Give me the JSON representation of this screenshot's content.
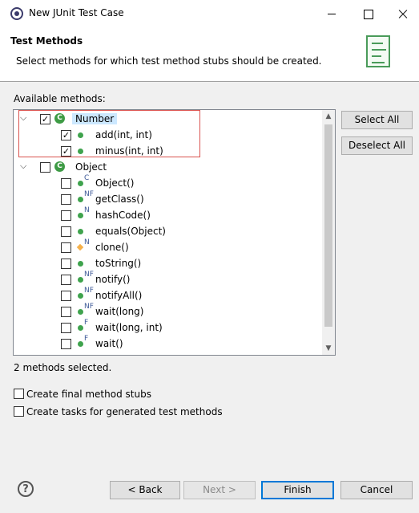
{
  "window": {
    "title": "New JUnit Test Case"
  },
  "header": {
    "title": "Test Methods",
    "description": "Select methods for which test method stubs should be created."
  },
  "tree": {
    "label": "Available methods:",
    "nodes": [
      {
        "label": "Number",
        "checked": true,
        "expanded": true,
        "icon": "class-icon",
        "children": [
          {
            "label": "add(int, int)",
            "checked": true,
            "modifier": ""
          },
          {
            "label": "minus(int, int)",
            "checked": true,
            "modifier": ""
          }
        ]
      },
      {
        "label": "Object",
        "checked": false,
        "expanded": true,
        "icon": "class-icon",
        "children": [
          {
            "label": "Object()",
            "checked": false,
            "modifier": "C"
          },
          {
            "label": "getClass()",
            "checked": false,
            "modifier": "NF"
          },
          {
            "label": "hashCode()",
            "checked": false,
            "modifier": "N"
          },
          {
            "label": "equals(Object)",
            "checked": false,
            "modifier": ""
          },
          {
            "label": "clone()",
            "checked": false,
            "modifier": "N"
          },
          {
            "label": "toString()",
            "checked": false,
            "modifier": ""
          },
          {
            "label": "notify()",
            "checked": false,
            "modifier": "NF"
          },
          {
            "label": "notifyAll()",
            "checked": false,
            "modifier": "NF"
          },
          {
            "label": "wait(long)",
            "checked": false,
            "modifier": "NF"
          },
          {
            "label": "wait(long, int)",
            "checked": false,
            "modifier": "F"
          },
          {
            "label": "wait()",
            "checked": false,
            "modifier": "F"
          }
        ]
      }
    ]
  },
  "side_buttons": {
    "select_all": "Select All",
    "deselect_all": "Deselect All"
  },
  "status": "2 methods selected.",
  "options": [
    {
      "label": "Create final method stubs",
      "checked": false
    },
    {
      "label": "Create tasks for generated test methods",
      "checked": false
    }
  ],
  "footer": {
    "back": "< Back",
    "next": "Next >",
    "finish": "Finish",
    "cancel": "Cancel"
  },
  "colors": {
    "accent": "#0078d7",
    "highlight_border": "#d9534f",
    "selection": "#cce8ff"
  }
}
